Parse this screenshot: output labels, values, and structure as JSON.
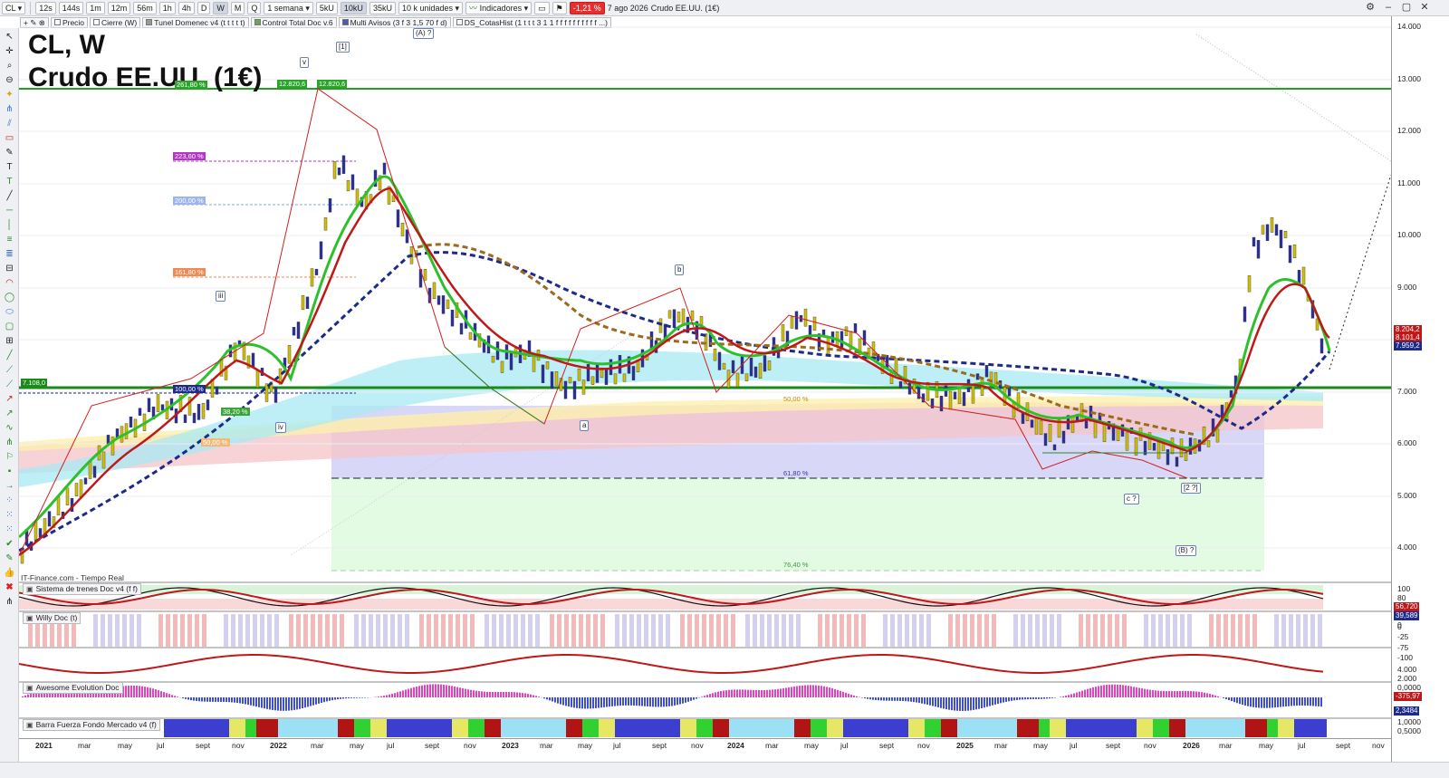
{
  "toolbar": {
    "symbol": "CL",
    "intervals": [
      "12s",
      "144s",
      "1m",
      "12m",
      "56m",
      "1h",
      "4h",
      "D",
      "W",
      "M",
      "Q"
    ],
    "period": "1 semana",
    "units": [
      "5kU",
      "10kU",
      "35kU"
    ],
    "units_select": "10 k unidades",
    "indicators_label": "Indicadores",
    "change": "-1,21 %",
    "date": "7 ago 2026",
    "instrument": "Crudo EE.UU. (1€)"
  },
  "studies": [
    "Precio",
    "Cierre (W)",
    "Tunel Domenec v4 (t t t t t)",
    "Control Total Doc v.6",
    "Multi Avisos (3 f 3 1,5 70 f d)",
    "DS_CotasHist (1 t t t 3 1 1 f f f f f f f f f f ...)"
  ],
  "chart_title": {
    "line1": "CL, W",
    "line2": "Crudo EE.UU. (1€)"
  },
  "yaxis": {
    "main": [
      "14.000",
      "13.000",
      "12.000",
      "11.000",
      "10.000",
      "9.000",
      "8.000",
      "7.000",
      "6.000",
      "5.000",
      "4.000"
    ],
    "osc1": [
      "100",
      "80",
      "50",
      "20",
      "0"
    ],
    "osc2": [
      "0",
      "-25",
      "-75",
      "-100"
    ],
    "osc3": [
      "4.000",
      "2.000",
      "0,0000"
    ],
    "osc4": [
      "2,0000",
      "1,0000",
      "0,5000"
    ],
    "price_tags": [
      "8.204,2",
      "8.101,4",
      "7.959,2"
    ],
    "osc_tags": [
      "56,720",
      "39,589",
      "-375,97",
      "2,3484"
    ]
  },
  "xaxis": [
    "2021",
    "mar",
    "may",
    "jul",
    "sept",
    "nov",
    "2022",
    "mar",
    "may",
    "jul",
    "sept",
    "nov",
    "2023",
    "mar",
    "may",
    "jul",
    "sept",
    "nov",
    "2024",
    "mar",
    "may",
    "jul",
    "sept",
    "nov",
    "2025",
    "mar",
    "may",
    "jul",
    "sept",
    "nov",
    "2026",
    "mar",
    "may",
    "jul",
    "sept",
    "nov"
  ],
  "wave_labels": [
    "(A) ?",
    "[1]",
    "v",
    "iii",
    "iv",
    "b",
    "a",
    "c ?",
    "[2 ?]",
    "(B) ?"
  ],
  "fib_levels": [
    "261,80 %",
    "223,60 %",
    "200,00 %",
    "161,80 %",
    "100,00 %",
    "38,20 %",
    "50,00 %"
  ],
  "fib_right": [
    "50,00 %",
    "61,80 %",
    "76,40 %"
  ],
  "annotations": {
    "high1": "12.820,6",
    "high2": "12.820,6",
    "level": "7.108,0"
  },
  "panels": [
    "Sistema de trenes Doc v4 (f f)",
    "Willy Doc (t)",
    "Awesome Evolution Doc",
    "Barra Fuerza Fondo Mercado v4 (f)"
  ],
  "footer": "IT-Finance.com - Tiempo Real",
  "colors": {
    "green": "#1fa31f",
    "navy": "#1c2a8a",
    "red": "#c01818",
    "brown": "#9b6a1a"
  }
}
